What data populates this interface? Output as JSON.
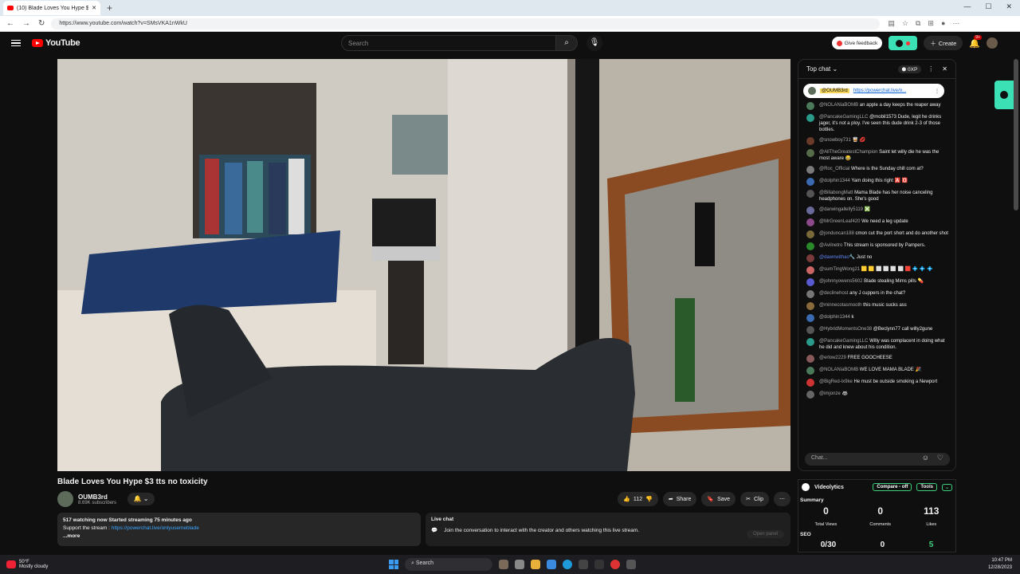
{
  "browser": {
    "tab_title": "(10) Blade Loves You Hype $3",
    "url": "https://www.youtube.com/watch?v=SMsVKA1nWkU"
  },
  "yt": {
    "logo": "YouTube",
    "search_placeholder": "Search",
    "give_feedback": "Give feedback",
    "create": "Create",
    "notif_count": "9+"
  },
  "video": {
    "title": "Blade Loves You Hype $3 tts no toxicity",
    "channel": "OUMB3rd",
    "subscribers": "8.69K subscribers",
    "likes": "112",
    "share": "Share",
    "save": "Save",
    "clip": "Clip"
  },
  "description": {
    "stats": "517 watching now  Started streaming 75 minutes ago",
    "support_prefix": "Support the stream : ",
    "support_link": "https://powerchat.live/onlyusemeblade",
    "more": "...more"
  },
  "live_chat_box": {
    "title": "Live chat",
    "text": "Join the conversation to interact with the creator and others watching this live stream.",
    "open_panel": "Open panel"
  },
  "chat": {
    "header": "Top chat",
    "xp": "0XP",
    "pinned_user": "@OUMB3rd",
    "pinned_link": "https://powerchat.live/o...",
    "input_placeholder": "Chat...",
    "messages": [
      {
        "author": "@NOLANiaBOMB",
        "text": "an apple a day keeps the reaper away",
        "color": "#4a7a5a"
      },
      {
        "author": "@PancakeGamingLLC",
        "text": "@mobil1573 Dude, legit he drinks jager, it's not a ploy. I've seen this dude drink 2-3 of those bottles.",
        "color": "#2a9a8a"
      },
      {
        "author": "@snowboy731",
        "text": "🥃 💋",
        "color": "#6a3a2a"
      },
      {
        "author": "@AllTheGreatestChampion",
        "text": "Saint let willy die he was the most aware 😂",
        "color": "#556b4a"
      },
      {
        "author": "@Roc_Official",
        "text": "Where is the Sunday chill com at?",
        "color": "#7a7a7a"
      },
      {
        "author": "@dolphin1344",
        "text": "Yam doing this right 🅰️ 🅾️",
        "color": "#3a6ab0"
      },
      {
        "author": "@BillabongMatt",
        "text": "Mama Blade has her noise canceling headphones on. She's good",
        "color": "#555"
      },
      {
        "author": "@darwingallelly5119",
        "text": "❎",
        "color": "#6a6a9a"
      },
      {
        "author": "@MrGreenLeaf420",
        "text": "We need a leg update",
        "color": "#8a4a8a"
      },
      {
        "author": "@jonduncan188",
        "text": "cmon cut the port short and do another shot",
        "color": "#7a6a3a"
      },
      {
        "author": "@Avilnetro",
        "text": "This stream is sponsored by Pampers.",
        "color": "#2a8a2a"
      },
      {
        "author": "@dawnwithao🔧",
        "text": "Just no",
        "color": "#7a3a3a",
        "blue": true
      },
      {
        "author": "@sumTingWong21",
        "text": "🟨 🟨 ⬜ ⬜ ⬜ ⬜ 🟥 💠 💠 💠",
        "color": "#c66"
      },
      {
        "author": "@johnnyowens5602",
        "text": "Blade stealing Mims pills 💊",
        "color": "#5a5ad0"
      },
      {
        "author": "@declinehost",
        "text": "any J cuppers in the chat?",
        "color": "#777"
      },
      {
        "author": "@minnecotasmooth",
        "text": "this music sucks ass",
        "color": "#8a6a3a"
      },
      {
        "author": "@dolphin1344",
        "text": "k",
        "color": "#3a6ab0"
      },
      {
        "author": "@HybridMomentsOne38",
        "text": "@Beclynn77 call willy2gune",
        "color": "#555"
      },
      {
        "author": "@PancakeGamingLLC",
        "text": "Willy was complacent in doing what he did and knew about his condition.",
        "color": "#2a9a8a"
      },
      {
        "author": "@erlow2229",
        "text": "FREE GOOCHEESE",
        "color": "#8a5a5a"
      },
      {
        "author": "@NOLANiaBOMB",
        "text": "WE LOVE MAMA BLADE 🎉",
        "color": "#4a7a5a"
      },
      {
        "author": "@BigRed-lx9ke",
        "text": "He must be outside smoking a Newport",
        "color": "#c33"
      },
      {
        "author": "@imjonze",
        "text": "🦝",
        "color": "#666"
      }
    ]
  },
  "videolytics": {
    "title": "Videolytics",
    "compare": "Compare - off",
    "tools": "Tools",
    "summary": "Summary",
    "total_views_label": "Total Views",
    "total_views": "0",
    "comments_label": "Comments",
    "comments": "0",
    "likes_label": "Likes",
    "likes": "113",
    "seo": "SEO",
    "seo_a": "0/30",
    "seo_b": "0",
    "seo_c": "5"
  },
  "taskbar": {
    "temp": "50°F",
    "weather": "Mostly cloudy",
    "search": "Search",
    "time": "10:47 PM",
    "date": "12/28/2023"
  }
}
